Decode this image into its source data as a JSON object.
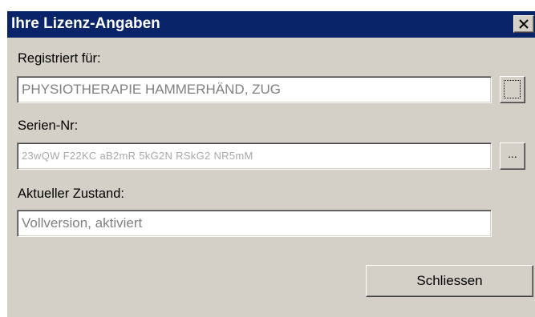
{
  "dialog": {
    "title": "Ihre Lizenz-Angaben"
  },
  "fields": {
    "registered_label": "Registriert für:",
    "registered_value": "PHYSIOTHERAPIE HAMMERHÄND, ZUG",
    "serial_label": "Serien-Nr:",
    "serial_value": "23wQW F22KC aB2mR 5kG2N RSkG2 NR5mM",
    "serial_button": "...",
    "status_label": "Aktueller Zustand:",
    "status_value": "Vollversion, aktiviert"
  },
  "buttons": {
    "close": "Schliessen"
  },
  "icons": {
    "title_close": "close-x-icon"
  },
  "colors": {
    "titlebar": "#0a246a",
    "dialog_bg": "#d4d0c8"
  }
}
